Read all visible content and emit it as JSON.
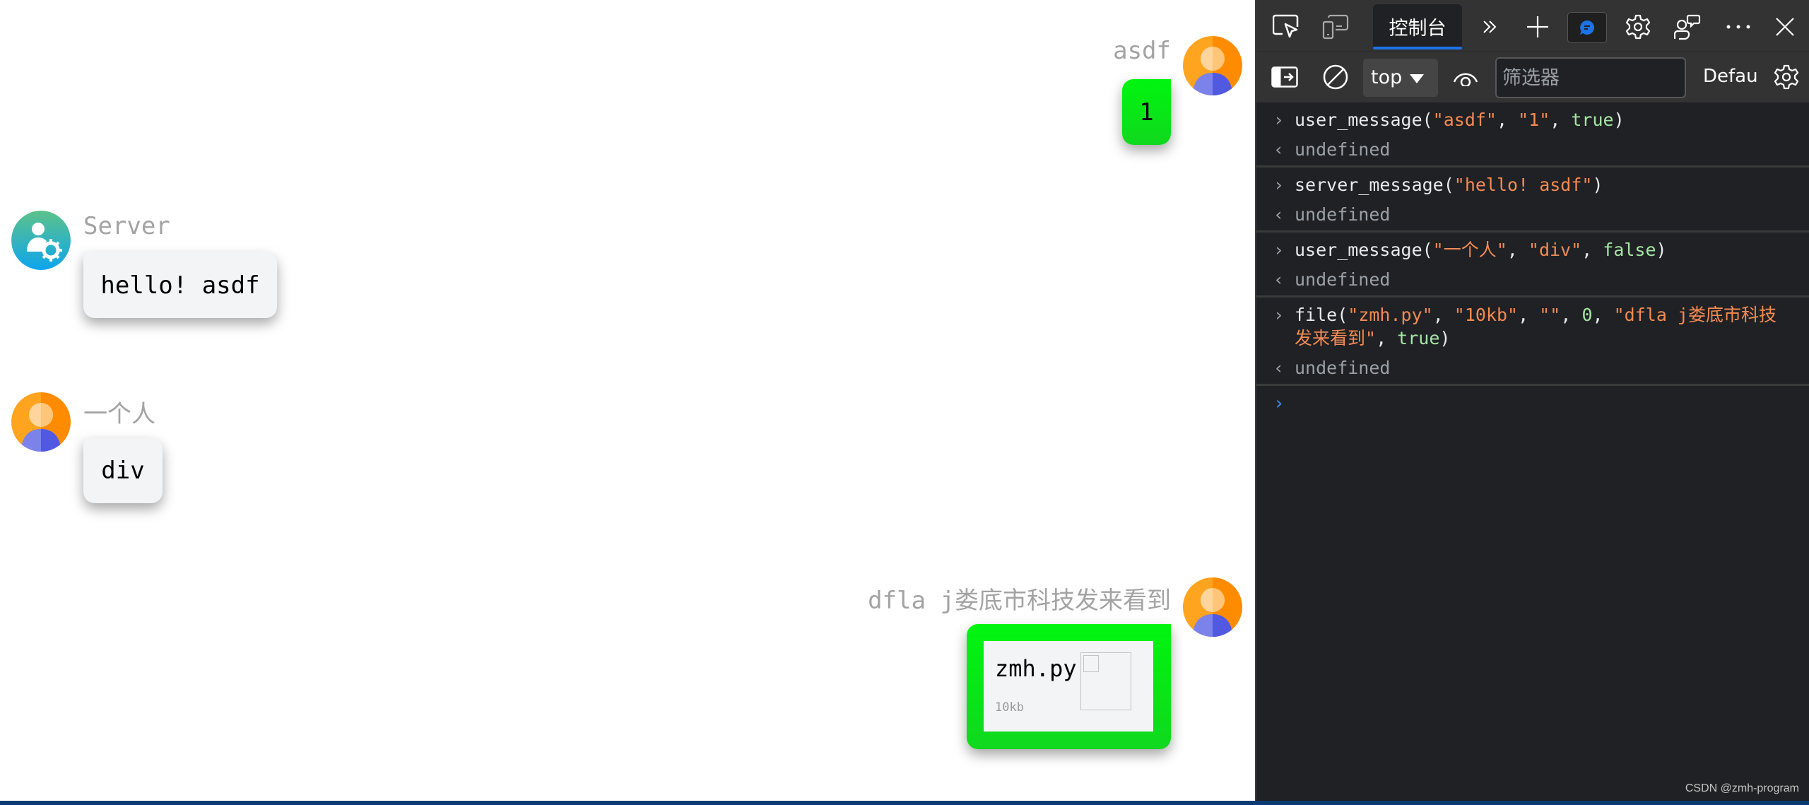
{
  "chat": {
    "messages": [
      {
        "type": "text",
        "sender": "asdf",
        "content": "1",
        "self": true,
        "avatar": "user-avatar-icon"
      },
      {
        "type": "text",
        "sender": "Server",
        "content": "hello! asdf",
        "self": false,
        "avatar": "server-avatar-icon"
      },
      {
        "type": "text",
        "sender": "一个人",
        "content": "div",
        "self": false,
        "avatar": "user-avatar-icon"
      },
      {
        "type": "file",
        "sender": "dfla j娄底市科技发来看到",
        "file_name": "zmh.py",
        "file_size": "10kb",
        "self": true,
        "avatar": "user-avatar-icon"
      }
    ]
  },
  "devtools": {
    "toolbar": {
      "inspect_icon": "inspect-element-icon",
      "device_icon": "device-emulation-icon",
      "active_tab": "控制台",
      "more_tabs_icon": "chevron-double-right-icon",
      "add_tab_icon": "plus-icon",
      "feedback_icon": "feedback-chat-icon",
      "settings_icon": "gear-icon",
      "user_feedback_icon": "person-feedback-icon",
      "more_icon": "ellipsis-icon",
      "close_icon": "close-icon"
    },
    "console_toolbar": {
      "sidebar_icon": "sidebar-toggle-icon",
      "clear_icon": "clear-console-icon",
      "context": "top",
      "live_expression_icon": "eye-icon",
      "filter_placeholder": "筛选器",
      "levels": "Defau",
      "settings_icon": "gear-icon"
    },
    "console": {
      "entries": [
        {
          "input": [
            [
              "fn",
              "user_message("
            ],
            [
              "str",
              "\"asdf\""
            ],
            [
              "fn",
              ", "
            ],
            [
              "str",
              "\"1\""
            ],
            [
              "fn",
              ", "
            ],
            [
              "kw",
              "true"
            ],
            [
              "fn",
              ")"
            ]
          ],
          "output": "undefined"
        },
        {
          "input": [
            [
              "fn",
              "server_message("
            ],
            [
              "str",
              "\"hello! asdf\""
            ],
            [
              "fn",
              ")"
            ]
          ],
          "output": "undefined"
        },
        {
          "input": [
            [
              "fn",
              "user_message("
            ],
            [
              "str",
              "\"一个人\""
            ],
            [
              "fn",
              ", "
            ],
            [
              "str",
              "\"div\""
            ],
            [
              "fn",
              ", "
            ],
            [
              "kw",
              "false"
            ],
            [
              "fn",
              ")"
            ]
          ],
          "output": "undefined"
        },
        {
          "input": [
            [
              "fn",
              "file("
            ],
            [
              "str",
              "\"zmh.py\""
            ],
            [
              "fn",
              ", "
            ],
            [
              "str",
              "\"10kb\""
            ],
            [
              "fn",
              ", "
            ],
            [
              "str",
              "\"\""
            ],
            [
              "fn",
              ", "
            ],
            [
              "num",
              "0"
            ],
            [
              "fn",
              ", "
            ],
            [
              "str",
              "\"dfla j娄底市科技发来看到\""
            ],
            [
              "fn",
              ", "
            ],
            [
              "kw",
              "true"
            ],
            [
              "fn",
              ")"
            ]
          ],
          "output": "undefined"
        }
      ],
      "input_prompt": "›"
    },
    "colors": {
      "string": "#f28b54",
      "keyword": "#a5e5a5",
      "accent": "#1a73e8"
    }
  },
  "watermark": "CSDN @zmh-program"
}
